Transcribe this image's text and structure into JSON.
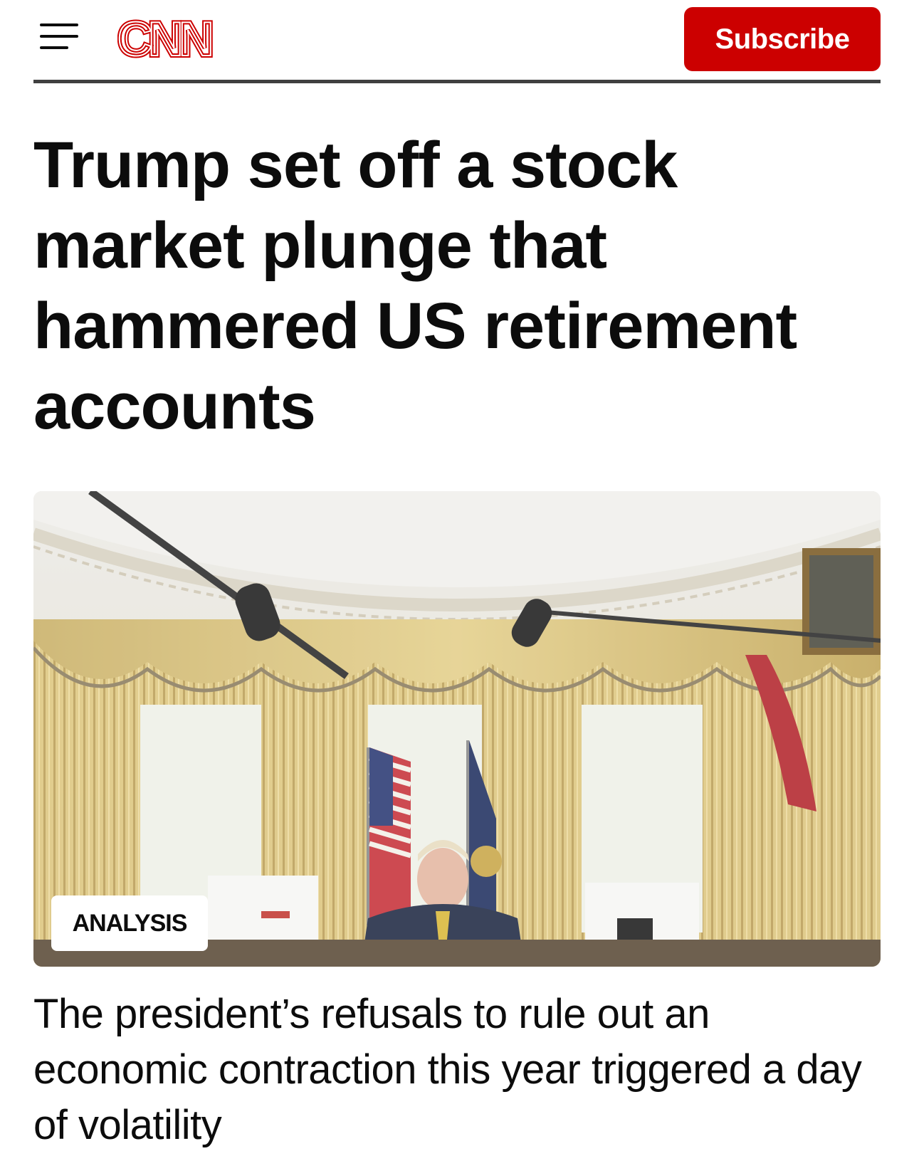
{
  "header": {
    "menu_icon": "hamburger-menu-icon",
    "logo_text": "CNN",
    "subscribe_label": "Subscribe",
    "brand_color": "#cc0000"
  },
  "article": {
    "headline": "Trump set off a stock market plunge that hammered US retirement accounts",
    "badge_label": "ANALYSIS",
    "subheadline": "The president’s refusals to rule out an economic contraction this year triggered a day of volatility"
  }
}
